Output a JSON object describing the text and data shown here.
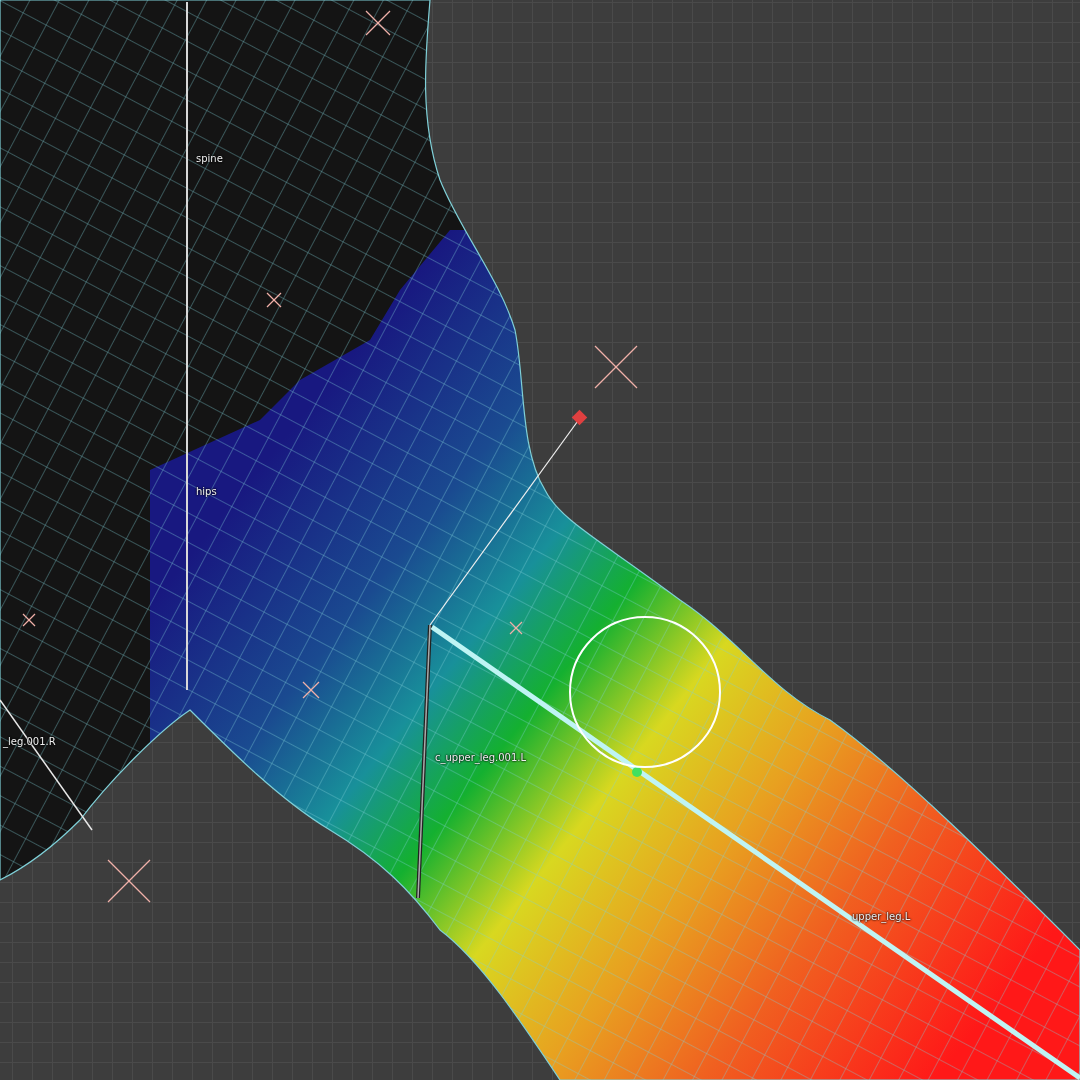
{
  "viewport": {
    "bone_labels": [
      {
        "text": "spine"
      },
      {
        "text": "hips"
      },
      {
        "text": "_leg.001.R"
      },
      {
        "text": "c_upper_leg.001.L"
      },
      {
        "text": "upper_leg.L"
      }
    ]
  }
}
